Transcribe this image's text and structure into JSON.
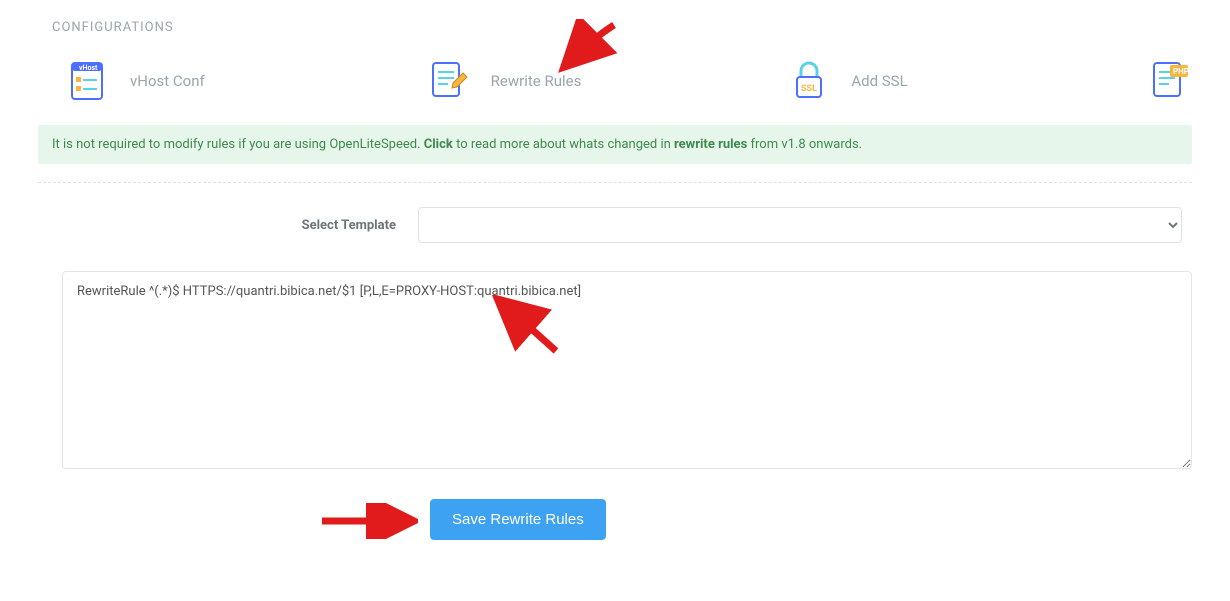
{
  "section_title": "CONFIGURATIONS",
  "configs": {
    "vhost": {
      "label": "vHost Conf"
    },
    "rewrite": {
      "label": "Rewrite Rules"
    },
    "ssl": {
      "label": "Add SSL"
    },
    "php": {
      "label": ""
    }
  },
  "alert": {
    "pre": "It is not required to modify rules if you are using OpenLiteSpeed. ",
    "click": "Click",
    "mid": " to read more about whats changed in ",
    "link": "rewrite rules",
    "post": " from v1.8 onwards."
  },
  "form": {
    "template_label": "Select Template",
    "template_value": ""
  },
  "rules_value": "RewriteRule ^(.*)$ HTTPS://quantri.bibica.net/$1 [P,L,E=PROXY-HOST:quantri.bibica.net]",
  "save_button": "Save Rewrite Rules"
}
